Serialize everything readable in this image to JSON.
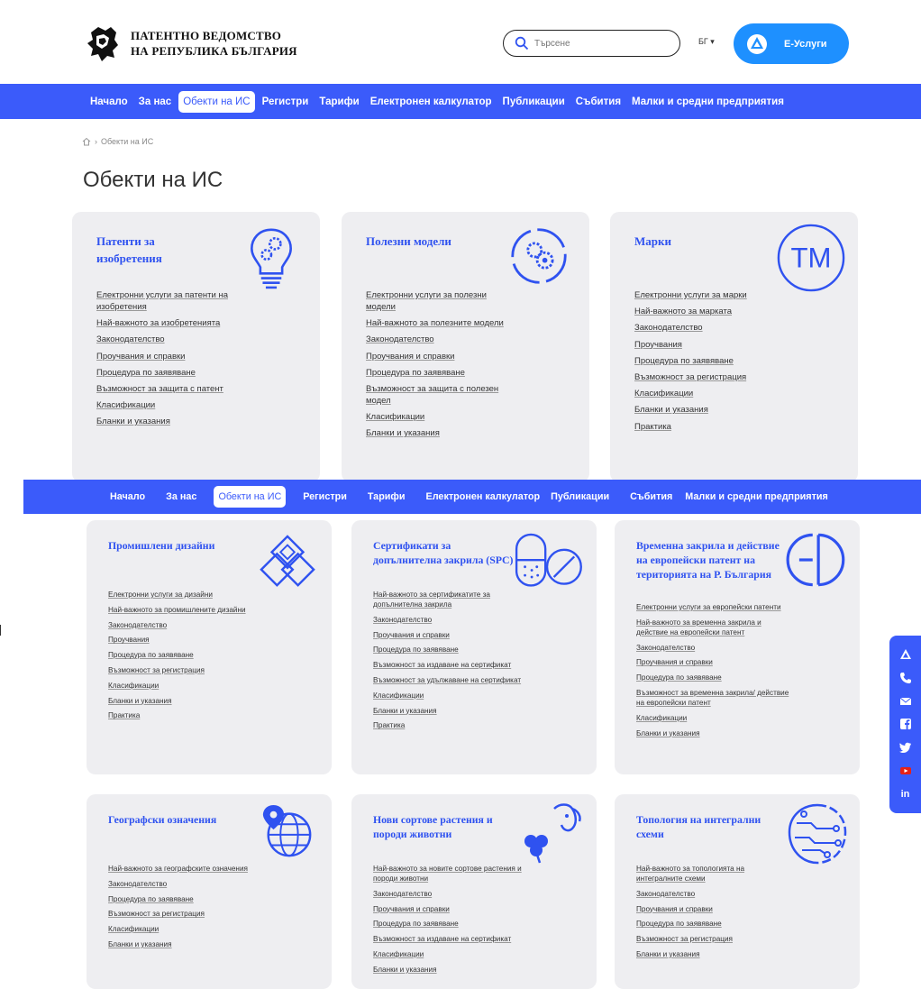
{
  "header": {
    "logo_line1": "ПАТЕНТНО ВЕДОМСТВО",
    "logo_line2": "НА РЕПУБЛИКА БЪЛГАРИЯ",
    "search_placeholder": "Търсене",
    "language": "БГ ▾",
    "eservices_label": "Е-Услуги"
  },
  "nav": {
    "items": [
      "Начало",
      "За нас",
      "Обекти на ИС",
      "Регистри",
      "Тарифи",
      "Електронен калкулатор",
      "Публикации",
      "Събития",
      "Малки и средни предприятия"
    ],
    "active_index": 2
  },
  "breadcrumb": {
    "current": "Обекти на ИС"
  },
  "page_title": "Обекти на ИС",
  "cards": [
    {
      "title": "Патенти за изобретения",
      "icon": "lightbulb-gears-icon",
      "links": [
        "Електронни услуги за патенти на изобретения",
        "Най-важното за изобретенията",
        "Законодателство",
        "Проучвания и справки",
        "Процедура по заявяване",
        "Възможност за защита с патент",
        "Класификации",
        "Бланки и указания"
      ]
    },
    {
      "title": "Полезни модели",
      "icon": "gears-circle-icon",
      "links": [
        "Електронни услуги за полезни модели",
        "Най-важното за полезните модели",
        "Законодателство",
        "Проучвания и справки",
        "Процедура по заявяване",
        "Възможност за защита с полезен модел",
        "Класификации",
        "Бланки и указания"
      ]
    },
    {
      "title": "Марки",
      "icon": "tm-icon",
      "links": [
        "Електронни услуги за марки",
        "Най-важното за марката",
        "Законодателство",
        "Проучвания",
        "Процедура по заявяване",
        "Възможност за регистрация",
        "Класификации",
        "Бланки и указания",
        "Практика"
      ]
    },
    {
      "title": "Промишлени дизайни",
      "icon": "design-pattern-icon",
      "links": [
        "Електронни услуги за дизайни",
        "Най-важното за промишлените дизайни",
        "Законодателство",
        "Проучвания",
        "Процедура по заявяване",
        "Възможност за регистрация",
        "Класификации",
        "Бланки и указания",
        "Практика"
      ]
    },
    {
      "title": "Сертификати за допълнителна закрила (SPC)",
      "icon": "pill-icon",
      "links": [
        "Най-важното за сертификатите за допълнителна закрила",
        "Законодателство",
        "Проучвания и справки",
        "Процедура по заявяване",
        "Възможност за издаване на сертификат",
        "Възможност за удължаване на сертификат",
        "Класификации",
        "Бланки и указания",
        "Практика"
      ]
    },
    {
      "title": "Временна закрила и действие на европейски патент на територията на Р. България",
      "icon": "ep-icon",
      "links": [
        "Електронни услуги за европейски патенти",
        "Най-важното за временна закрила и действие на европейски патент",
        "Законодателство",
        "Проучвания и справки",
        "Процедура по заявяване",
        "Възможност за временна закрила/ действие на европейски патент",
        "Класификации",
        "Бланки и указания"
      ]
    },
    {
      "title": "Географски означения",
      "icon": "globe-pin-icon",
      "links": [
        "Най-важното за географските означения",
        "Законодателство",
        "Процедура по заявяване",
        "Възможност за регистрация",
        "Класификации",
        "Бланки и указания"
      ]
    },
    {
      "title": "Нови сортове растения и породи животни",
      "icon": "clover-dog-icon",
      "links": [
        "Най-важното за новите сортове растения и породи животни",
        "Законодателство",
        "Проучвания и справки",
        "Процедура по заявяване",
        "Възможност за издаване на сертификат",
        "Класификации",
        "Бланки и указания"
      ]
    },
    {
      "title": "Топология на интегрални схеми",
      "icon": "circuit-brain-icon",
      "links": [
        "Най-важното за топологията на интегралните схеми",
        "Законодателство",
        "Проучвания и справки",
        "Процедура по заявяване",
        "Възможност за регистрация",
        "Бланки и указания"
      ]
    }
  ],
  "social": [
    "eservices-icon",
    "phone-icon",
    "mail-icon",
    "facebook-icon",
    "twitter-icon",
    "youtube-icon",
    "linkedin-icon"
  ],
  "colors": {
    "accent": "#3b5bfa",
    "title_blue": "#2f52f0",
    "card_bg": "#eeeef1",
    "eservices_bg": "#1e90ff"
  }
}
